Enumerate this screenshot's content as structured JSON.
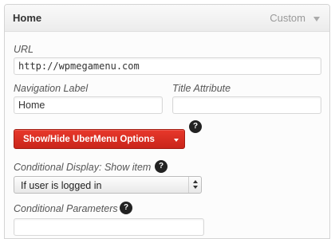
{
  "header": {
    "title": "Home",
    "type_label": "Custom"
  },
  "url": {
    "label": "URL",
    "value": "http://wpmegamenu.com"
  },
  "navigation_label": {
    "label": "Navigation Label",
    "value": "Home"
  },
  "title_attribute": {
    "label": "Title Attribute",
    "value": ""
  },
  "ubermenu_button": {
    "label": "Show/Hide UberMenu Options"
  },
  "help_icon": {
    "glyph": "?"
  },
  "conditional_display": {
    "label": "Conditional Display: Show item",
    "selected": "If user is logged in"
  },
  "conditional_parameters": {
    "label": "Conditional Parameters",
    "value": ""
  },
  "colors": {
    "button_red": "#d8301f",
    "help_bg": "#222222",
    "label_text": "#555555"
  }
}
